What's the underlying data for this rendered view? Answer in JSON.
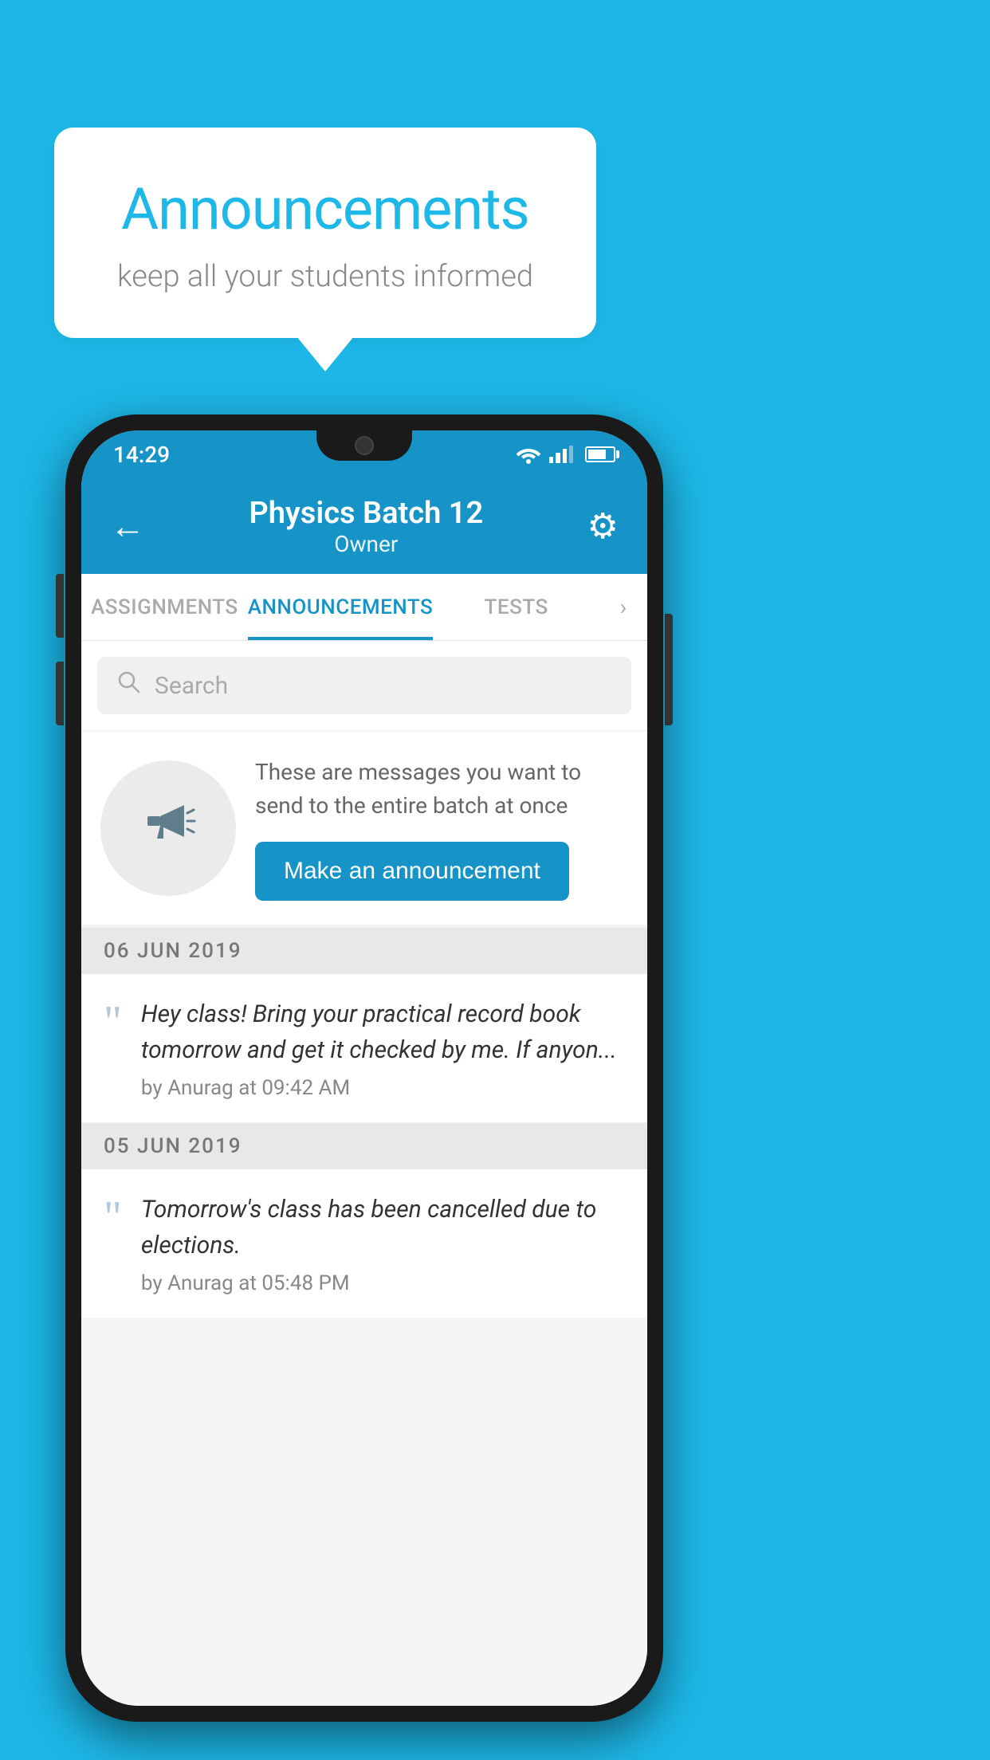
{
  "background_color": "#1db8e8",
  "speech_bubble": {
    "title": "Announcements",
    "subtitle": "keep all your students informed"
  },
  "phone": {
    "status_bar": {
      "time": "14:29"
    },
    "header": {
      "back_label": "←",
      "batch_name": "Physics Batch 12",
      "owner_label": "Owner",
      "gear_label": "⚙"
    },
    "tabs": [
      {
        "label": "ASSIGNMENTS",
        "active": false
      },
      {
        "label": "ANNOUNCEMENTS",
        "active": true
      },
      {
        "label": "TESTS",
        "active": false
      }
    ],
    "tab_more": "›",
    "search": {
      "placeholder": "Search"
    },
    "promo": {
      "description_text": "These are messages you want to send to the entire batch at once",
      "button_label": "Make an announcement"
    },
    "announcement_groups": [
      {
        "date": "06  JUN  2019",
        "items": [
          {
            "text": "Hey class! Bring your practical record book tomorrow and get it checked by me. If anyon...",
            "meta": "by Anurag at 09:42 AM"
          }
        ]
      },
      {
        "date": "05  JUN  2019",
        "items": [
          {
            "text": "Tomorrow's class has been cancelled due to elections.",
            "meta": "by Anurag at 05:48 PM"
          }
        ]
      }
    ]
  }
}
